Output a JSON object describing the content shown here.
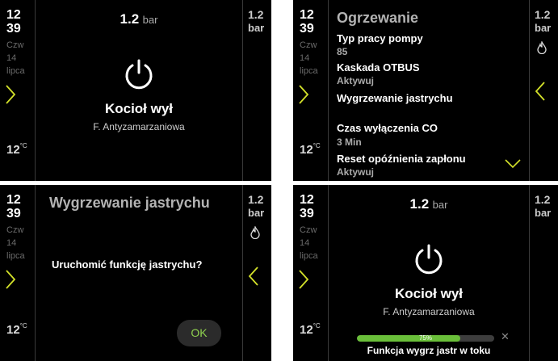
{
  "panels": [
    {
      "side": {
        "hour": "12",
        "minute": "39",
        "day": "Czw",
        "date": "14",
        "month": "lipca",
        "temp": "12",
        "temp_unit": "°C"
      },
      "pressure": {
        "value": "1.2",
        "unit": "bar"
      },
      "status": {
        "state": "Kocioł wył",
        "sub": "F. Antyzamarzaniowa"
      },
      "right": {
        "value": "1.2",
        "unit": "bar"
      }
    },
    {
      "side": {
        "hour": "12",
        "minute": "39",
        "day": "Czw",
        "date": "14",
        "month": "lipca",
        "temp": "12",
        "temp_unit": "°C"
      },
      "title": "Ogrzewanie",
      "items": [
        {
          "label": "Typ pracy pompy",
          "value": "85"
        },
        {
          "label": "Kaskada OTBUS",
          "value": "Aktywuj"
        },
        {
          "label": "Wygrzewanie jastrychu",
          "value": ""
        },
        {
          "label": "Czas wyłączenia CO",
          "value": "3 Min"
        },
        {
          "label": "Reset opóźnienia zapłonu",
          "value": "Aktywuj"
        }
      ],
      "right": {
        "value": "1.2",
        "unit": "bar"
      }
    },
    {
      "side": {
        "hour": "12",
        "minute": "39",
        "day": "Czw",
        "date": "14",
        "month": "lipca",
        "temp": "12",
        "temp_unit": "°C"
      },
      "title": "Wygrzewanie jastrychu",
      "question": "Uruchomić funkcję jastrychu?",
      "ok_label": "OK",
      "right": {
        "value": "1.2",
        "unit": "bar"
      }
    },
    {
      "side": {
        "hour": "12",
        "minute": "39",
        "day": "Czw",
        "date": "14",
        "month": "lipca",
        "temp": "12",
        "temp_unit": "°C"
      },
      "pressure": {
        "value": "1.2",
        "unit": "bar"
      },
      "status": {
        "state": "Kocioł wył",
        "sub": "F. Antyzamarzaniowa"
      },
      "progress": {
        "percent": 75,
        "label": "75%",
        "text": "Funkcja wygrz jastr w toku"
      },
      "right": {
        "value": "1.2",
        "unit": "bar"
      }
    }
  ],
  "colors": {
    "accent_green": "#8fd14f",
    "chevron_yellow": "#d4e22a",
    "progress_fill": "#6abf3a",
    "background": "#000000"
  },
  "icons": [
    "power-icon",
    "chevron-right-icon",
    "chevron-left-icon",
    "chevron-down-icon",
    "flame-icon",
    "close-icon"
  ]
}
